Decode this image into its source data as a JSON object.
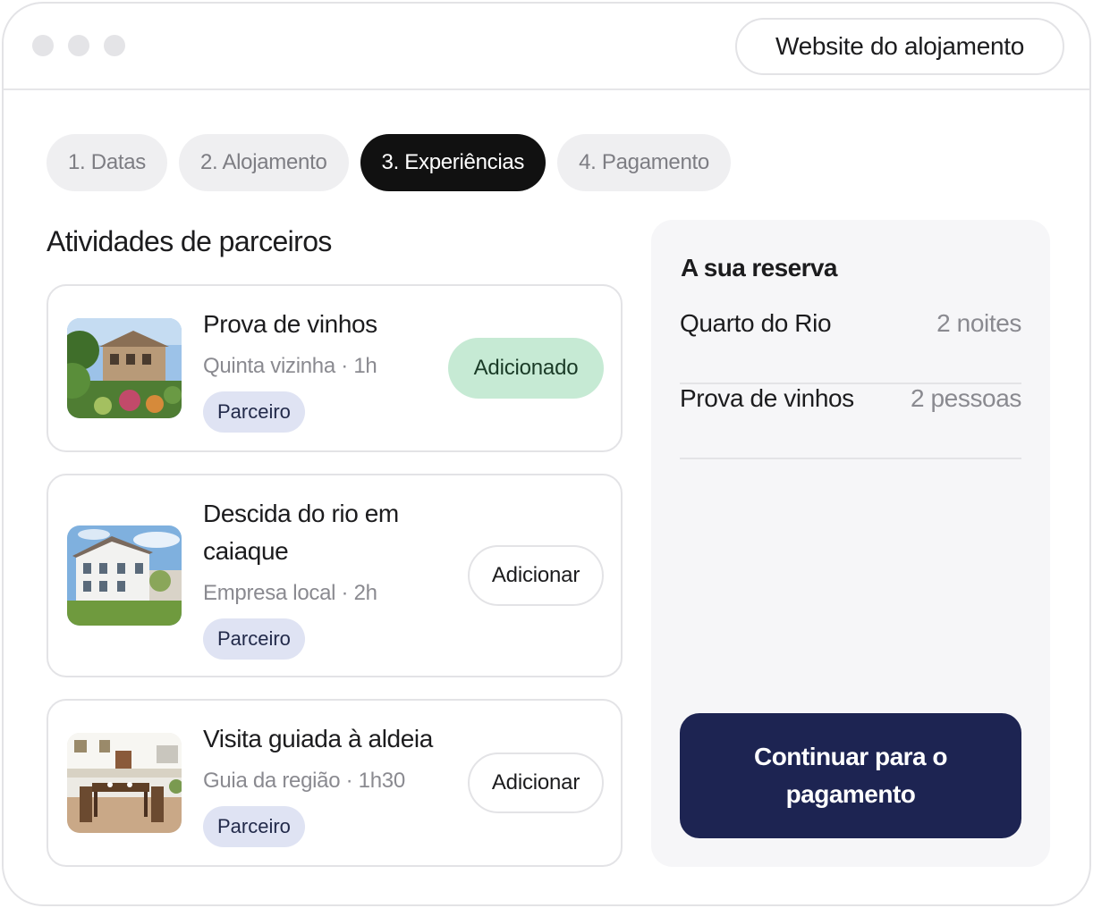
{
  "header": {
    "website_button": "Website do alojamento"
  },
  "steps": [
    {
      "label": "1. Datas",
      "active": false
    },
    {
      "label": "2. Alojamento",
      "active": false
    },
    {
      "label": "3. Experiências",
      "active": true
    },
    {
      "label": "4. Pagamento",
      "active": false
    }
  ],
  "activities": {
    "title": "Atividades de parceiros",
    "items": [
      {
        "title": "Prova de vinhos",
        "meta": "Quinta vizinha · 1h",
        "badge": "Parceiro",
        "action": "Adicionado",
        "added": true
      },
      {
        "title": "Descida do rio em caiaque",
        "meta": "Empresa local · 2h",
        "badge": "Parceiro",
        "action": "Adicionar",
        "added": false
      },
      {
        "title": "Visita guiada à aldeia",
        "meta": "Guia da região · 1h30",
        "badge": "Parceiro",
        "action": "Adicionar",
        "added": false
      }
    ]
  },
  "summary": {
    "title": "A sua reserva",
    "rows": [
      {
        "label": "Quarto do Rio",
        "value": "2 noites"
      },
      {
        "label": "Prova de vinhos",
        "value": "2 pessoas"
      }
    ],
    "continue_label": "Continuar para o pagamento"
  },
  "colors": {
    "active_step": "#111111",
    "added_button": "#c6ead4",
    "badge": "#dfe3f3",
    "primary": "#1d2452"
  }
}
